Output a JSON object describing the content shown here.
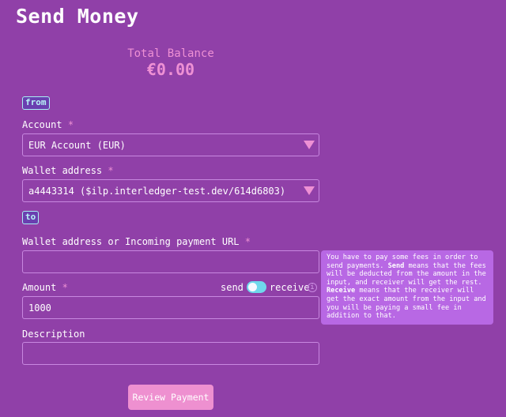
{
  "page": {
    "title": "Send Money"
  },
  "balance": {
    "label": "Total Balance",
    "value": "€0.00"
  },
  "sections": {
    "from_tag": "from",
    "to_tag": "to"
  },
  "form": {
    "required_marker": "*",
    "account": {
      "label": "Account",
      "value": "EUR Account (EUR)"
    },
    "wallet_address": {
      "label": "Wallet address",
      "value": "a4443314 ($ilp.interledger-test.dev/614d6803)"
    },
    "receiver": {
      "label": "Wallet address or Incoming payment URL",
      "value": ""
    },
    "amount": {
      "label": "Amount",
      "value": "1000",
      "toggle_left": "send",
      "toggle_right": "receive",
      "info_glyph": "i"
    },
    "description": {
      "label": "Description",
      "value": ""
    },
    "submit_label": "Review Payment"
  },
  "tooltip": {
    "part1": "You have to pay some fees in order to send payments. ",
    "send_word": "Send",
    "part2": " means that the fees will be deducted from the amount in the input, and receiver will get the rest. ",
    "receive_word": "Receive",
    "part3": " means that the receiver will get the exact amount from the input and you will be paying a small fee in addition to that."
  },
  "colors": {
    "background": "#9040a8",
    "accent_pink": "#ee90d4",
    "toggle_cyan": "#6fd8ec",
    "tooltip_bg": "#b868e4"
  },
  "icons": {
    "dropdown": "caret-down-icon",
    "info": "info-icon"
  }
}
